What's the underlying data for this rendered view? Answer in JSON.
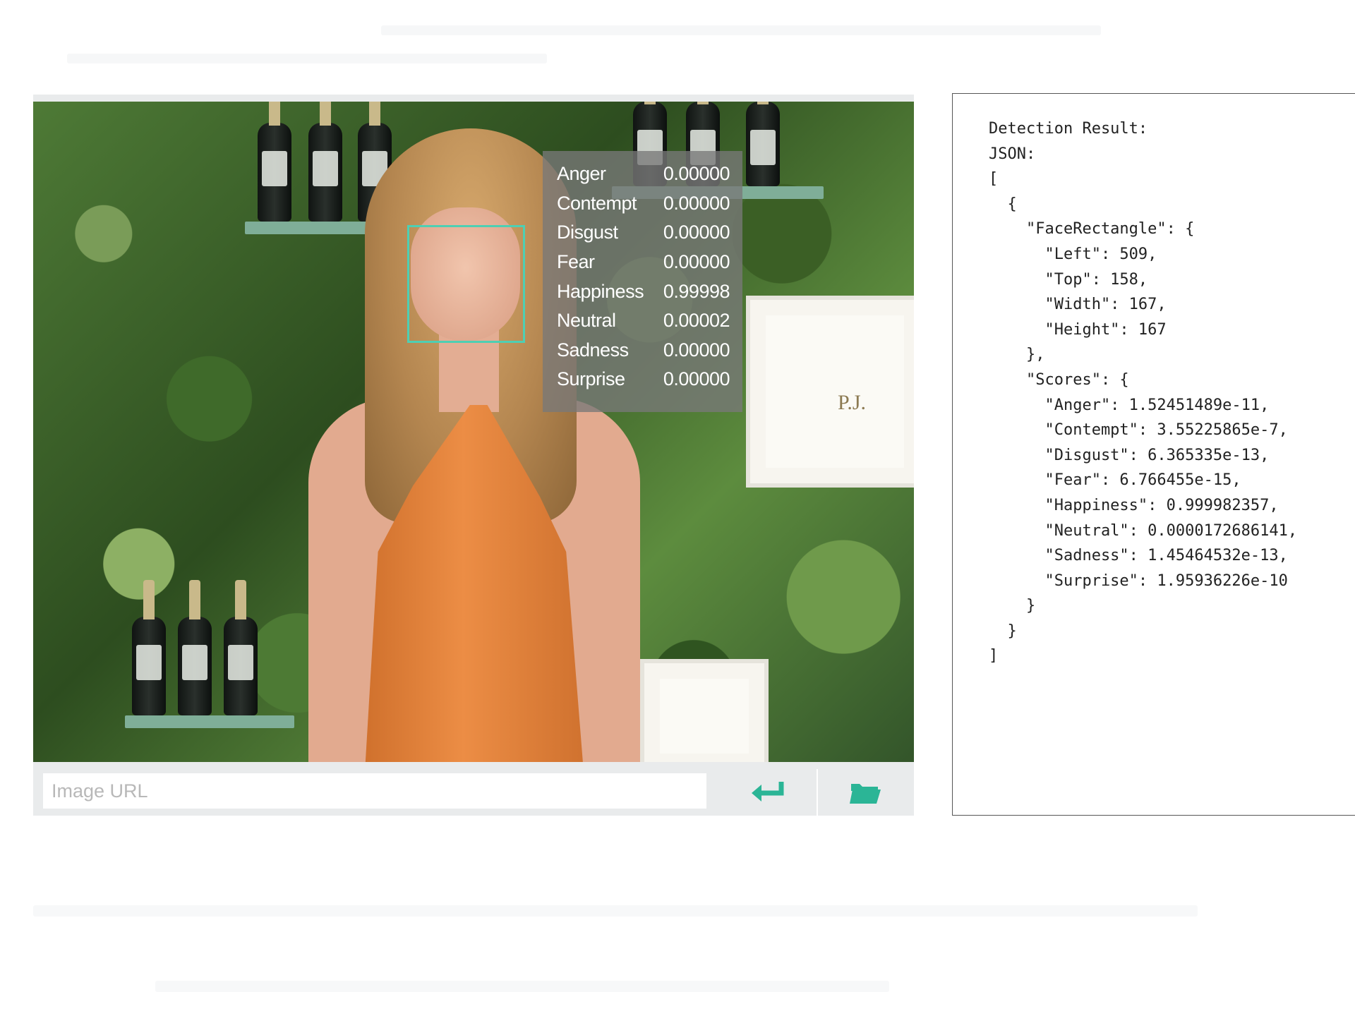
{
  "demo": {
    "emotion_scores": [
      {
        "emotion": "Anger",
        "value": "0.00000"
      },
      {
        "emotion": "Contempt",
        "value": "0.00000"
      },
      {
        "emotion": "Disgust",
        "value": "0.00000"
      },
      {
        "emotion": "Fear",
        "value": "0.00000"
      },
      {
        "emotion": "Happiness",
        "value": "0.99998"
      },
      {
        "emotion": "Neutral",
        "value": "0.00002"
      },
      {
        "emotion": "Sadness",
        "value": "0.00000"
      },
      {
        "emotion": "Surprise",
        "value": "0.00000"
      }
    ],
    "url_input": {
      "placeholder": "Image URL",
      "value": ""
    },
    "enter_icon": "enter-arrow-icon",
    "folder_icon": "folder-open-icon",
    "accent_color": "#4ecfb3"
  },
  "result": {
    "text": "Detection Result:\nJSON:\n[\n  {\n    \"FaceRectangle\": {\n      \"Left\": 509,\n      \"Top\": 158,\n      \"Width\": 167,\n      \"Height\": 167\n    },\n    \"Scores\": {\n      \"Anger\": 1.52451489e-11,\n      \"Contempt\": 3.55225865e-7,\n      \"Disgust\": 6.365335e-13,\n      \"Fear\": 6.766455e-15,\n      \"Happiness\": 0.999982357,\n      \"Neutral\": 0.0000172686141,\n      \"Sadness\": 1.45464532e-13,\n      \"Surprise\": 1.95936226e-10\n    }\n  }\n]"
  }
}
